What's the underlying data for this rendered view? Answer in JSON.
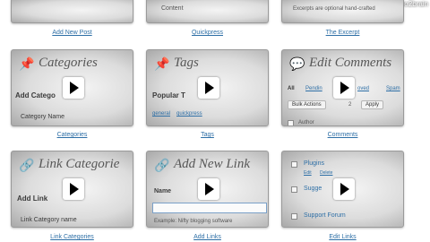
{
  "top_row": [
    {
      "caption": "Add New Post"
    },
    {
      "caption": "Quickpress",
      "inner": "Content"
    },
    {
      "caption": "The Excerpt",
      "inner": "Excerpts are optional hand-crafted"
    }
  ],
  "watermark": "© video2brain",
  "videos": {
    "categories": {
      "title": "Categories",
      "caption": "Categories",
      "heading": "Add Catego",
      "field_label": "Category Name",
      "icon": "pin-icon"
    },
    "tags": {
      "title": "Tags",
      "caption": "Tags",
      "heading": "Popular T",
      "links": [
        "general",
        "quickpress"
      ],
      "icon": "pin-icon"
    },
    "comments": {
      "title": "Edit Comments",
      "caption": "Comments",
      "filters": [
        "All",
        "Pendin",
        "oved",
        "Spam"
      ],
      "bulk_label": "Bulk Actions",
      "count": "2",
      "apply_label": "Apply",
      "author_label": "Author",
      "icon": "comment-icon"
    },
    "link_categories": {
      "title": "Link Categorie",
      "caption": "Link Categories",
      "heading": "Add Link",
      "field_label": "Link Category name",
      "icon": "link-icon"
    },
    "add_links": {
      "title": "Add New Link",
      "caption": "Add Links",
      "name_label": "Name",
      "example": "Example: Nifty blogging software",
      "icon": "link-icon"
    },
    "edit_links": {
      "caption": "Edit Links",
      "items": [
        "Plugins",
        "Sugge",
        "Support Forum"
      ],
      "sub_links": [
        "Edit",
        "Delete"
      ]
    }
  }
}
